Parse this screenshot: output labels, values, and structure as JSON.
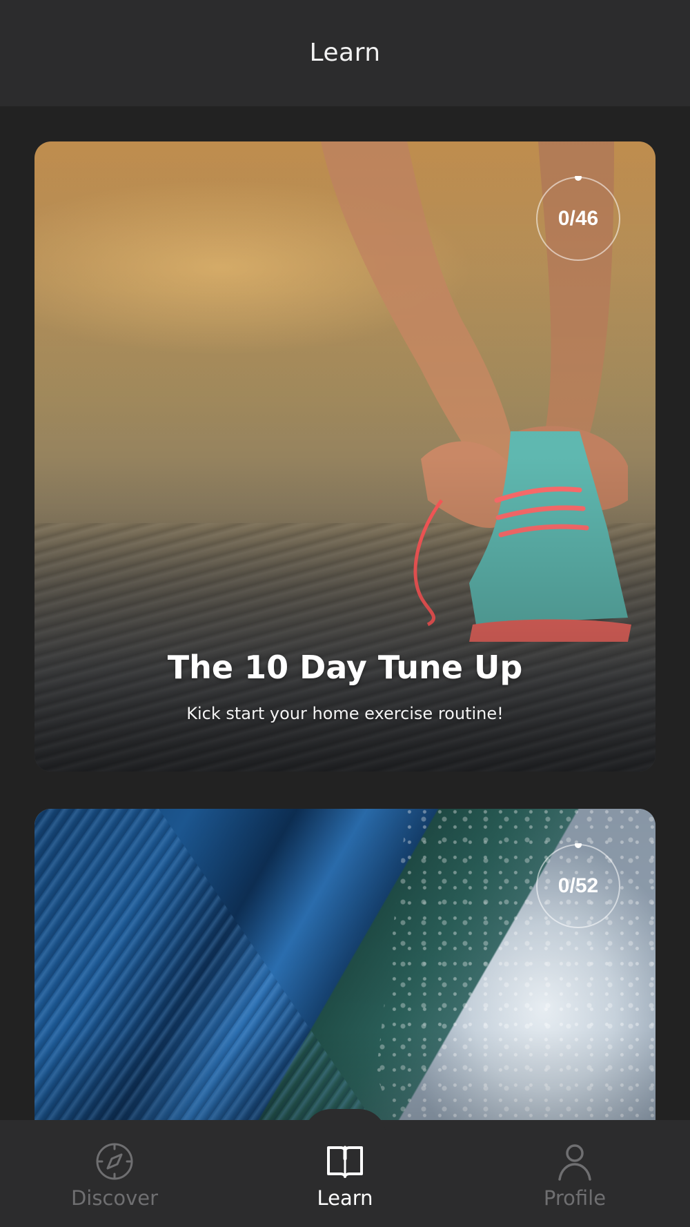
{
  "header": {
    "title": "Learn"
  },
  "cards": [
    {
      "title": "The 10 Day Tune Up",
      "subtitle": "Kick start your home exercise routine!",
      "progress": "0/46"
    },
    {
      "title": "",
      "subtitle": "",
      "progress": "0/52"
    }
  ],
  "tabs": [
    {
      "label": "Discover",
      "icon": "compass-icon",
      "active": false
    },
    {
      "label": "Learn",
      "icon": "book-icon",
      "active": true
    },
    {
      "label": "Profile",
      "icon": "person-icon",
      "active": false
    }
  ],
  "colors": {
    "background": "#222222",
    "bar": "#2c2c2d",
    "active": "#ffffff",
    "inactive": "#6f6f71"
  }
}
